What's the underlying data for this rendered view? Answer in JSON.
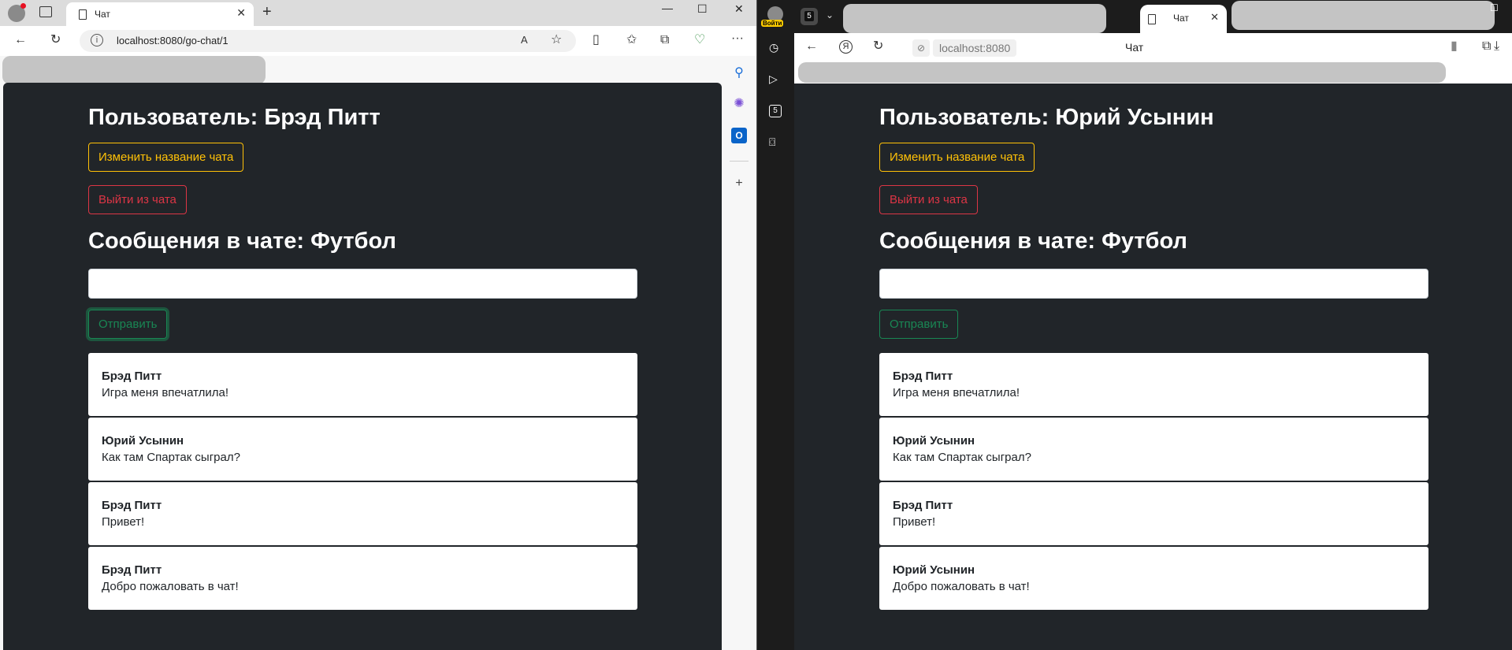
{
  "left_browser": {
    "tab_title": "Чат",
    "url": "localhost:8080/go-chat/1",
    "page": {
      "user_heading": "Пользователь: Брэд Питт",
      "rename_chat_button": "Изменить название чата",
      "leave_chat_button": "Выйти из чата",
      "chat_heading": "Сообщения в чате: Футбол",
      "message_input_value": "",
      "send_button": "Отправить",
      "messages": [
        {
          "author": "Брэд Питт",
          "text": "Игра меня впечатлила!"
        },
        {
          "author": "Юрий Усынин",
          "text": "Как там Спартак сыграл?"
        },
        {
          "author": "Брэд Питт",
          "text": "Привет!"
        },
        {
          "author": "Брэд Питт",
          "text": "Добро пожаловать в чат!"
        }
      ]
    }
  },
  "right_browser": {
    "profile_label": "Войти",
    "tab_badge": "5",
    "sidebar_badge": "5",
    "tab_title": "Чат",
    "url": "localhost:8080",
    "page_title": "Чат",
    "page": {
      "user_heading": "Пользователь: Юрий Усынин",
      "rename_chat_button": "Изменить название чата",
      "leave_chat_button": "Выйти из чата",
      "chat_heading": "Сообщения в чате: Футбол",
      "message_input_value": "",
      "send_button": "Отправить",
      "messages": [
        {
          "author": "Брэд Питт",
          "text": "Игра меня впечатлила!"
        },
        {
          "author": "Юрий Усынин",
          "text": "Как там Спартак сыграл?"
        },
        {
          "author": "Брэд Питт",
          "text": "Привет!"
        },
        {
          "author": "Юрий Усынин",
          "text": "Добро пожаловать в чат!"
        }
      ]
    }
  },
  "colors": {
    "page_bg": "#212529",
    "warning": "#ffc107",
    "danger": "#dc3545",
    "success": "#198754"
  }
}
